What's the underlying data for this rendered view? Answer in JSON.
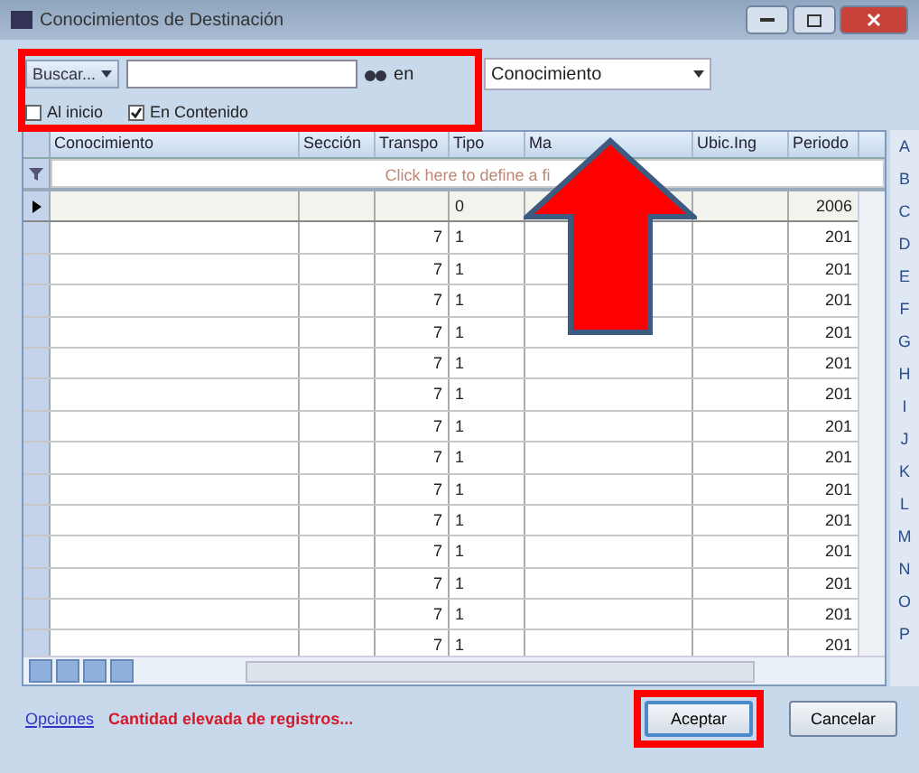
{
  "window": {
    "title": "Conocimientos de Destinación"
  },
  "search": {
    "button": "Buscar...",
    "in_label": "en",
    "field": "Conocimiento"
  },
  "options": [
    {
      "label": "Al inicio",
      "checked": false
    },
    {
      "label": "En Contenido",
      "checked": true
    }
  ],
  "table": {
    "columns": [
      "Conocimiento",
      "Sección",
      "Transpo",
      "Tipo",
      "Ma",
      "Ubic.Ing",
      "Periodo"
    ],
    "filter_hint": "Click here to define a fi",
    "rows": [
      {
        "selected": true,
        "cells": [
          "",
          "",
          "",
          "0",
          "",
          "",
          "2006"
        ]
      },
      {
        "selected": false,
        "cells": [
          "",
          "",
          "7",
          "1",
          "",
          "",
          "201"
        ]
      },
      {
        "selected": false,
        "cells": [
          "",
          "",
          "7",
          "1",
          "",
          "",
          "201"
        ]
      },
      {
        "selected": false,
        "cells": [
          "",
          "",
          "7",
          "1",
          "",
          "",
          "201"
        ]
      },
      {
        "selected": false,
        "cells": [
          "",
          "",
          "7",
          "1",
          "",
          "",
          "201"
        ]
      },
      {
        "selected": false,
        "cells": [
          "",
          "",
          "7",
          "1",
          "",
          "",
          "201"
        ]
      },
      {
        "selected": false,
        "cells": [
          "",
          "",
          "7",
          "1",
          "",
          "",
          "201"
        ]
      },
      {
        "selected": false,
        "cells": [
          "",
          "",
          "7",
          "1",
          "",
          "",
          "201"
        ]
      },
      {
        "selected": false,
        "cells": [
          "",
          "",
          "7",
          "1",
          "",
          "",
          "201"
        ]
      },
      {
        "selected": false,
        "cells": [
          "",
          "",
          "7",
          "1",
          "",
          "",
          "201"
        ]
      },
      {
        "selected": false,
        "cells": [
          "",
          "",
          "7",
          "1",
          "",
          "",
          "201"
        ]
      },
      {
        "selected": false,
        "cells": [
          "",
          "",
          "7",
          "1",
          "",
          "",
          "201"
        ]
      },
      {
        "selected": false,
        "cells": [
          "",
          "",
          "7",
          "1",
          "",
          "",
          "201"
        ]
      },
      {
        "selected": false,
        "cells": [
          "",
          "",
          "7",
          "1",
          "",
          "",
          "201"
        ]
      },
      {
        "selected": false,
        "cells": [
          "",
          "",
          "7",
          "1",
          "",
          "",
          "201"
        ]
      }
    ]
  },
  "alphabet": [
    "A",
    "B",
    "C",
    "D",
    "E",
    "F",
    "G",
    "H",
    "I",
    "J",
    "K",
    "L",
    "M",
    "N",
    "O",
    "P"
  ],
  "status": {
    "link": "Opciones",
    "message": "Cantidad elevada de registros..."
  },
  "buttons": [
    {
      "label": "Aceptar",
      "kind": "default"
    },
    {
      "label": "Cancelar",
      "kind": "normal"
    }
  ],
  "annotations": [
    {
      "kind": "frame"
    },
    {
      "kind": "arrow"
    },
    {
      "kind": "frame"
    }
  ]
}
